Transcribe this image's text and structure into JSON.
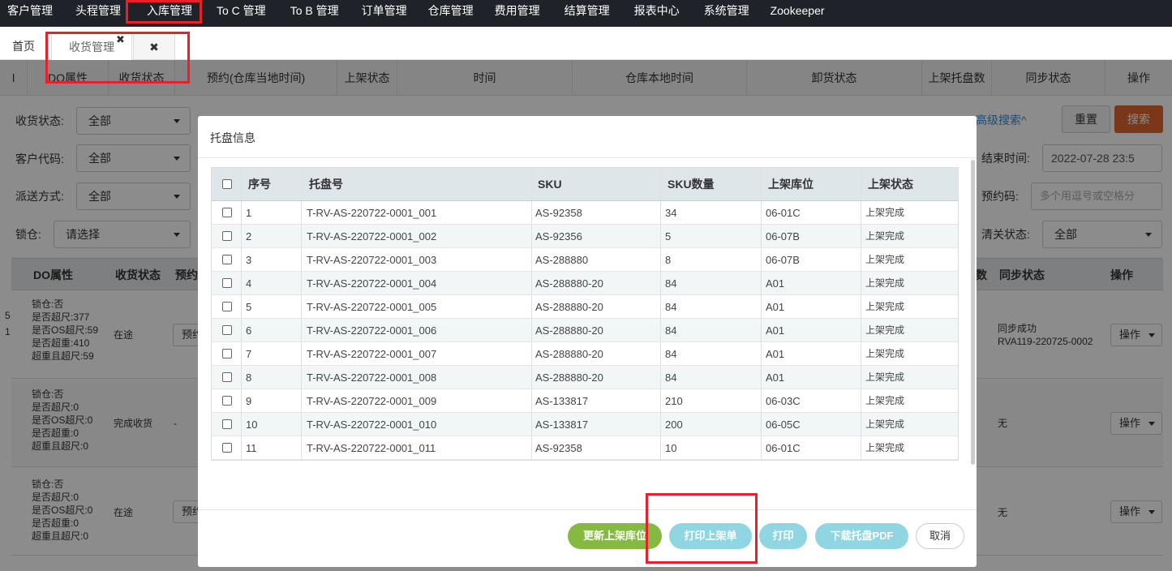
{
  "nav": {
    "items": [
      "客户管理",
      "头程管理",
      "入库管理",
      "To C 管理",
      "To B 管理",
      "订单管理",
      "仓库管理",
      "费用管理",
      "结算管理",
      "报表中心",
      "系统管理",
      "Zookeeper"
    ]
  },
  "tabs": {
    "home": "首页",
    "active": "收货管理",
    "close_small": "✖",
    "close_all": "✖"
  },
  "background": {
    "ghost_header": [
      "l",
      "DO属性",
      "收货状态",
      "预约(仓库当地时间)",
      "上架状态",
      "时间",
      "仓库本地时间",
      "卸货状态",
      "上架托盘数",
      "同步状态",
      "操作"
    ],
    "filters": {
      "receive_status_label": "收货状态:",
      "receive_status_value": "全部",
      "customer_code_label": "客户代码:",
      "customer_code_value": "全部",
      "delivery_label": "派送方式:",
      "delivery_value": "全部",
      "lock_label": "锁仓:",
      "lock_value": "请选择",
      "adv_search": "高级搜索^",
      "reset": "重置",
      "search": "搜索",
      "end_time_label": "结束时间:",
      "end_time_value": "2022-07-28 23:5",
      "appt_code_label": "预约码:",
      "appt_code_placeholder": "多个用逗号或空格分",
      "customs_label": "清关状态:",
      "customs_value": "全部"
    },
    "table_headers": [
      "DO属性",
      "收货状态",
      "预约",
      "数",
      "同步状态",
      "操作"
    ],
    "rows": [
      {
        "attrs": [
          "锁仓:否",
          "是否超尺:377",
          "是否OS超尺:59",
          "是否超重:410",
          "超重且超尺:59"
        ],
        "status": "在途",
        "pre": "预约",
        "sync": [
          "同步成功",
          "RVA119-220725-0002"
        ],
        "op": "操作",
        "edge": [
          "5",
          "1"
        ]
      },
      {
        "attrs": [
          "锁仓:否",
          "是否超尺:0",
          "是否OS超尺:0",
          "是否超重:0",
          "超重且超尺:0"
        ],
        "status": "完成收货",
        "pre": "-",
        "sync": [
          "无"
        ],
        "op": "操作",
        "edge": []
      },
      {
        "attrs": [
          "锁仓:否",
          "是否超尺:0",
          "是否OS超尺:0",
          "是否超重:0",
          "超重且超尺:0"
        ],
        "status": "在途",
        "pre": "预约",
        "sync": [
          "无"
        ],
        "op": "操作",
        "edge": []
      }
    ]
  },
  "modal": {
    "title": "托盘信息",
    "headers": [
      "序号",
      "托盘号",
      "SKU",
      "SKU数量",
      "上架库位",
      "上架状态"
    ],
    "rows": [
      [
        "1",
        "T-RV-AS-220722-0001_001",
        "AS-92358",
        "34",
        "06-01C",
        "上架完成"
      ],
      [
        "2",
        "T-RV-AS-220722-0001_002",
        "AS-92356",
        "5",
        "06-07B",
        "上架完成"
      ],
      [
        "3",
        "T-RV-AS-220722-0001_003",
        "AS-288880",
        "8",
        "06-07B",
        "上架完成"
      ],
      [
        "4",
        "T-RV-AS-220722-0001_004",
        "AS-288880-20",
        "84",
        "A01",
        "上架完成"
      ],
      [
        "5",
        "T-RV-AS-220722-0001_005",
        "AS-288880-20",
        "84",
        "A01",
        "上架完成"
      ],
      [
        "6",
        "T-RV-AS-220722-0001_006",
        "AS-288880-20",
        "84",
        "A01",
        "上架完成"
      ],
      [
        "7",
        "T-RV-AS-220722-0001_007",
        "AS-288880-20",
        "84",
        "A01",
        "上架完成"
      ],
      [
        "8",
        "T-RV-AS-220722-0001_008",
        "AS-288880-20",
        "84",
        "A01",
        "上架完成"
      ],
      [
        "9",
        "T-RV-AS-220722-0001_009",
        "AS-133817",
        "210",
        "06-03C",
        "上架完成"
      ],
      [
        "10",
        "T-RV-AS-220722-0001_010",
        "AS-133817",
        "200",
        "06-05C",
        "上架完成"
      ],
      [
        "11",
        "T-RV-AS-220722-0001_011",
        "AS-92358",
        "10",
        "06-01C",
        "上架完成"
      ]
    ],
    "buttons": {
      "update_location": "更新上架库位",
      "print_putaway": "打印上架单",
      "print": "打印",
      "download_pdf": "下载托盘PDF",
      "cancel": "取消"
    }
  },
  "colors": {
    "highlight": "#e8202a",
    "search_btn": "#e0642f",
    "green_btn": "#86b941",
    "cyan_btn": "#8fd6e2"
  }
}
